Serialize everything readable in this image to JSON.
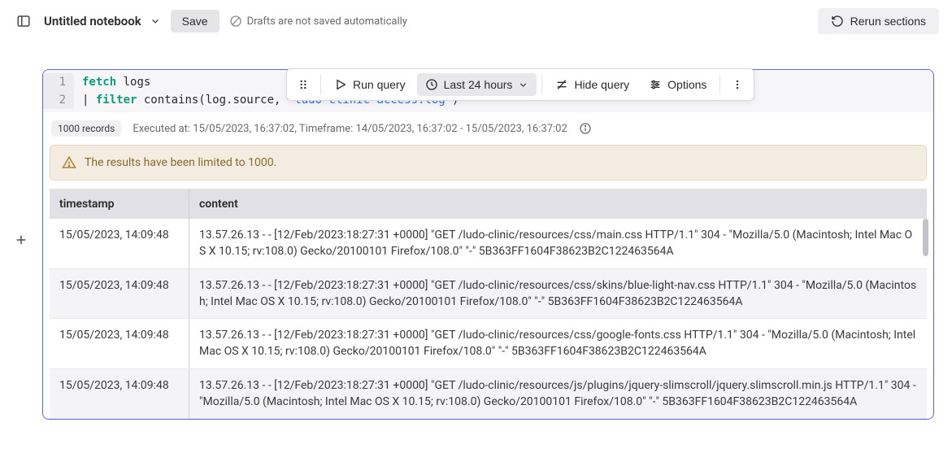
{
  "header": {
    "title": "Untitled notebook",
    "save_label": "Save",
    "drafts_note": "Drafts are not saved automatically",
    "rerun_label": "Rerun sections"
  },
  "toolbar": {
    "run_query": "Run query",
    "timeframe": "Last 24 hours",
    "hide_query": "Hide query",
    "options": "Options"
  },
  "query": {
    "line1_kw": "fetch",
    "line1_rest": " logs",
    "line2_pipe": "| ",
    "line2_kw": "filter",
    "line2_fn": " contains(log.source, ",
    "line2_str": "\"ludo-clinic-access.log\"",
    "line2_close": ")"
  },
  "meta": {
    "records": "1000 records",
    "executed": "Executed at: 15/05/2023, 16:37:02, Timeframe: 14/05/2023, 16:37:02 - 15/05/2023, 16:37:02"
  },
  "warning": "The results have been limited to 1000.",
  "table": {
    "columns": [
      "timestamp",
      "content"
    ],
    "rows": [
      {
        "timestamp": "15/05/2023, 14:09:48",
        "content": "13.57.26.13 - - [12/Feb/2023:18:27:31 +0000] \"GET /ludo-clinic/resources/css/main.css HTTP/1.1\" 304 - \"Mozilla/5.0 (Macintosh; Intel Mac OS X 10.15; rv:108.0) Gecko/20100101 Firefox/108.0\" \"-\" 5B363FF1604F38623B2C122463564A"
      },
      {
        "timestamp": "15/05/2023, 14:09:48",
        "content": "13.57.26.13 - - [12/Feb/2023:18:27:31 +0000] \"GET /ludo-clinic/resources/css/skins/blue-light-nav.css HTTP/1.1\" 304 - \"Mozilla/5.0 (Macintosh; Intel Mac OS X 10.15; rv:108.0) Gecko/20100101 Firefox/108.0\" \"-\" 5B363FF1604F38623B2C122463564A"
      },
      {
        "timestamp": "15/05/2023, 14:09:48",
        "content": "13.57.26.13 - - [12/Feb/2023:18:27:31 +0000] \"GET /ludo-clinic/resources/css/google-fonts.css HTTP/1.1\" 304 - \"Mozilla/5.0 (Macintosh; Intel Mac OS X 10.15; rv:108.0) Gecko/20100101 Firefox/108.0\" \"-\" 5B363FF1604F38623B2C122463564A"
      },
      {
        "timestamp": "15/05/2023, 14:09:48",
        "content": "13.57.26.13 - - [12/Feb/2023:18:27:31 +0000] \"GET /ludo-clinic/resources/js/plugins/jquery-slimscroll/jquery.slimscroll.min.js HTTP/1.1\" 304 - \"Mozilla/5.0 (Macintosh; Intel Mac OS X 10.15; rv:108.0) Gecko/20100101 Firefox/108.0\" \"-\" 5B363FF1604F38623B2C122463564A"
      }
    ]
  }
}
